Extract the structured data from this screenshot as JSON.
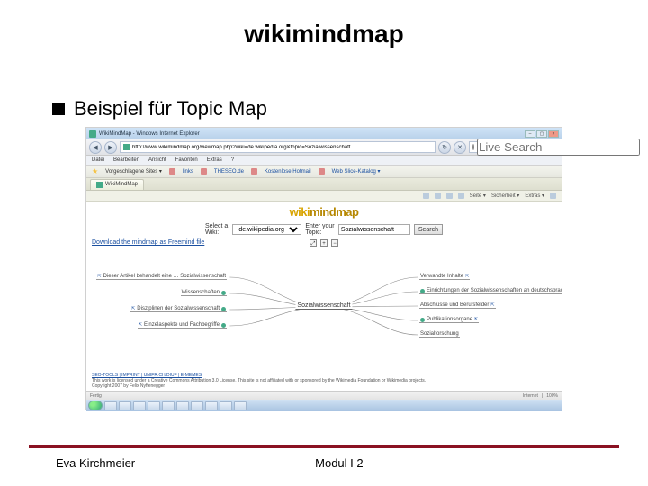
{
  "slide": {
    "title": "wikimindmap",
    "bullet": "Beispiel für Topic Map",
    "footer_author": "Eva Kirchmeier",
    "footer_module": "Modul I 2"
  },
  "browser": {
    "window_title": "WikiMindMap - Windows Internet Explorer",
    "url": "http://www.wikimindmap.org/viewmap.php?wiki=de.wikipedia.org&topic=Sozialwissenschaft",
    "search_placeholder": "Live Search",
    "menu": {
      "file": "Datei",
      "edit": "Bearbeiten",
      "view": "Ansicht",
      "favorites": "Favoriten",
      "extras": "Extras",
      "help": "?"
    },
    "favbar": {
      "suggested": "Vorgeschlagene Sites ▾",
      "links": {
        "a": "links",
        "b": "THESEO.de",
        "c": "Kostenlose Hotmail",
        "d": "Web Slice-Katalog ▾"
      }
    },
    "tab": "WikiMindMap",
    "toolbar": {
      "page": "Seite ▾",
      "safety": "Sicherheit ▾",
      "extras": "Extras ▾"
    },
    "status": {
      "done": "Fertig",
      "zone": "Internet",
      "zoom": "100%"
    }
  },
  "page": {
    "logo_a": "wiki",
    "logo_b": "mindmap",
    "select_label": "Select a Wiki:",
    "select_value": "de.wikipedia.org",
    "topic_label": "Enter your Topic:",
    "topic_value": "Sozialwissenschaft",
    "search_btn": "Search",
    "top_link": "Download the mindmap as Freemind file",
    "map": {
      "center": "Sozialwissenschaft",
      "left": [
        "Dieser Artikel behandelt eine … Sozialwissenschaft",
        "Wissenschaften",
        "Disziplinen der Sozialwissenschaft",
        "Einzelaspekte und Fachbegriffe"
      ],
      "right": [
        "Verwandte Inhalte",
        "Einrichtungen der Sozialwissenschaften an deutschsprachigen Universitäten",
        "Abschlüsse und Berufsfelder",
        "Publikationsorgane",
        "Sozialforschung"
      ]
    },
    "footer_seo": "SEO-TOOLS | IMPRINT | UNIFR.CH/DIUF | E-MEMES",
    "footer_note": "This work is licensed under a Creative Commons Attribution 3.0 License. This site is not affiliated with or sponsored by the Wikimedia Foundation or Wikimedia projects.",
    "footer_copy": "Copyright 2007 by Felix Nyffenegger"
  }
}
